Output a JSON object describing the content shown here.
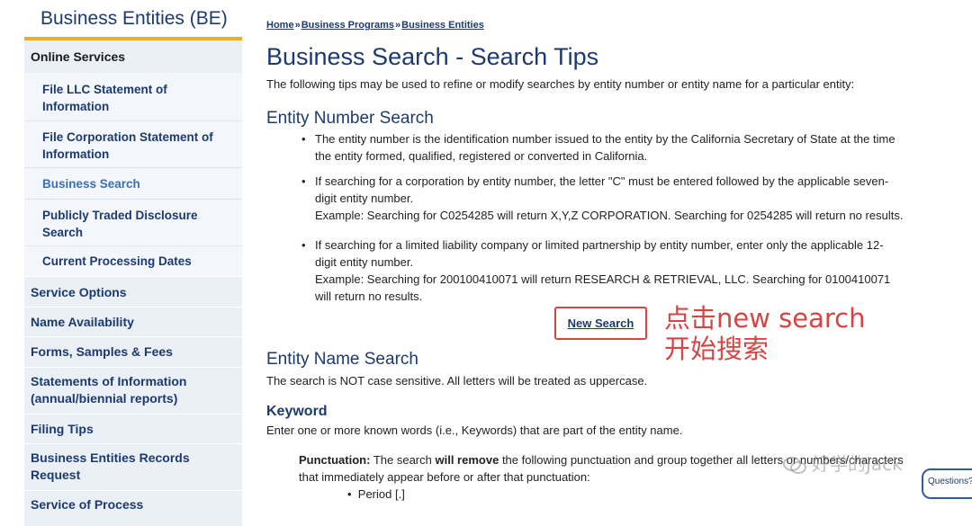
{
  "sidebar": {
    "title": "Business Entities (BE)",
    "online_services": "Online Services",
    "subitems": [
      {
        "label_line1": "File LLC Statement of",
        "label_line2": "Information"
      },
      {
        "label_line1": "File Corporation Statement of",
        "label_line2": "Information"
      },
      {
        "label_line1": "Business Search",
        "label_line2": ""
      },
      {
        "label_line1": "Publicly Traded Disclosure",
        "label_line2": "Search"
      },
      {
        "label_line1": "Current Processing Dates",
        "label_line2": ""
      }
    ],
    "items": [
      {
        "label_line1": "Service Options",
        "label_line2": ""
      },
      {
        "label_line1": "Name Availability",
        "label_line2": ""
      },
      {
        "label_line1": "Forms, Samples & Fees",
        "label_line2": ""
      },
      {
        "label_line1": "Statements of Information",
        "label_line2": "(annual/biennial reports)"
      },
      {
        "label_line1": "Filing Tips",
        "label_line2": ""
      },
      {
        "label_line1": "Business Entities Records",
        "label_line2": "Request"
      },
      {
        "label_line1": "Service of Process",
        "label_line2": ""
      }
    ]
  },
  "breadcrumb": {
    "home": "Home",
    "programs": "Business Programs",
    "entities": "Business Entities",
    "separator": "»"
  },
  "page": {
    "title": "Business Search - Search Tips",
    "intro": "The following tips may be used to refine or modify searches by entity number or entity name for a particular entity:",
    "entity_number_heading": "Entity Number Search",
    "bullets": [
      {
        "lines": [
          "The entity number is the identification number issued to the entity by the California Secretary of State at the time",
          "the entity formed, qualified, registered or converted in California."
        ]
      },
      {
        "lines": [
          "If searching for a corporation by entity number, the letter \"C\" must be entered followed by the applicable seven-",
          "digit entity number.",
          "Example: Searching for C0254285 will return X,Y,Z CORPORATION. Searching for 0254285 will return no results."
        ]
      },
      {
        "lines": [
          "If searching for a limited liability company or limited partnership by entity number, enter only the applicable 12-",
          "digit entity number.",
          "Example: Searching for 200100410071 will return RESEARCH & RETRIEVAL, LLC. Searching for 0100410071",
          "will return no results."
        ]
      }
    ],
    "new_search_button": "New Search",
    "annotation_line1": "点击new search",
    "annotation_line2": "开始搜索",
    "entity_name_heading": "Entity Name Search",
    "entity_name_text": "The search is NOT case sensitive. All letters will be treated as uppercase.",
    "keyword_heading": "Keyword",
    "keyword_text": "Enter one or more known words (i.e., Keywords) that are part of the entity name.",
    "punctuation_label": "Punctuation:",
    "punctuation_text_a": "The search",
    "punctuation_bold": "will remove",
    "punctuation_text_b": "the following punctuation and group together all letters or numbers/characters",
    "punctuation_line2": "that immediately appear before or after that punctuation:",
    "period_item": "Period [.]"
  },
  "watermark": {
    "text": "好学的Jack"
  },
  "questions_tab": {
    "label": "Questions?"
  },
  "colors": {
    "brand_navy": "#1c3a6e",
    "accent_gold": "#f0ad22",
    "annotation_red": "#d64545",
    "sidebar_bg": "#eaf0f6"
  }
}
